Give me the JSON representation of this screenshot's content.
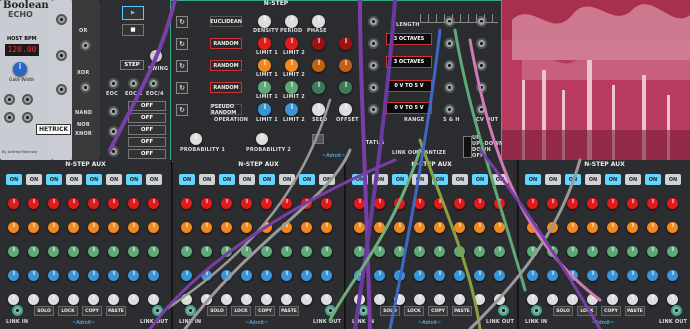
{
  "left_module": {
    "title": "Boolean",
    "subtitle": "ECHO",
    "bpm_label": "HOST BPM",
    "bpm_value": "120.00",
    "gate_label": "Gate Width",
    "tag": "Gate",
    "brand": "HETRICK",
    "credit": "By Andrew Mannsky"
  },
  "logic": {
    "labels": [
      "OR",
      "XOR",
      "NAND",
      "NOR",
      "XNOR"
    ],
    "step_label": "STEP",
    "swing_label": "SWING",
    "bottom_labels": [
      "EOC",
      "EOC/2",
      "EOC/4"
    ],
    "off_buttons": [
      "OFF",
      "OFF",
      "OFF",
      "OFF",
      "OFF"
    ]
  },
  "sequencer": {
    "title": "N-STEP",
    "modes": [
      "EUCLIDEAN",
      "RANDOM",
      "RANDOM",
      "RANDOM",
      "PSEUDO RANDOM"
    ],
    "col_labels": [
      "DENSITY",
      "PERIOD",
      "PHASE"
    ],
    "row_labels": [
      [
        "LIMIT 1",
        "LIMIT 2"
      ],
      [
        "LIMIT 1",
        "LIMIT 2"
      ],
      [
        "LIMIT 1",
        "LIMIT 2"
      ],
      [
        "OPERATION",
        "LIMIT 1",
        "LIMIT 2",
        "SEED",
        "OFFSET"
      ]
    ],
    "bottom": [
      "PROBABILITY 1",
      "PROBABILITY 2"
    ],
    "brand": "~Adroit~",
    "length": "LENGTH",
    "ranges": [
      "3 OCTAVES",
      "3 OCTAVES",
      "0 V TO 5 V",
      "0 V TO 5 V"
    ],
    "range_label": "RANGE",
    "sh_label": "S & H",
    "cv_label": "CV OUT",
    "status": "STATUS",
    "link_out": "LINK OUT",
    "quantize": "QUANTIZE",
    "toggle": [
      "UP",
      "UP+DOWN",
      "DOWN",
      "OFF"
    ]
  },
  "aux_panels": [
    {
      "title": "N-STEP AUX",
      "brand": "~Adroit~"
    },
    {
      "title": "N-STEP AUX",
      "brand": "~Adroit~"
    },
    {
      "title": "N-STEP AUX",
      "brand": "~Adroit~"
    },
    {
      "title": "N-STEP AUX",
      "brand": "~Adroit~"
    }
  ],
  "aux_common": {
    "on_labels": [
      "ON",
      "ON",
      "ON",
      "ON",
      "ON",
      "ON",
      "ON",
      "ON"
    ],
    "link_in": "LINK IN",
    "solo": "SOLO",
    "lock": "LOCK",
    "copy": "COPY",
    "paste": "PASTE",
    "link_out": "LINK OUT"
  },
  "colors": {
    "accent": "#62d6ff",
    "red": "#e11b1b",
    "orange": "#f08a1e",
    "green": "#5fa878",
    "blue": "#3a95d6",
    "cable_purple": "#7a3fa6",
    "cable_gray": "#9d9d9d"
  }
}
